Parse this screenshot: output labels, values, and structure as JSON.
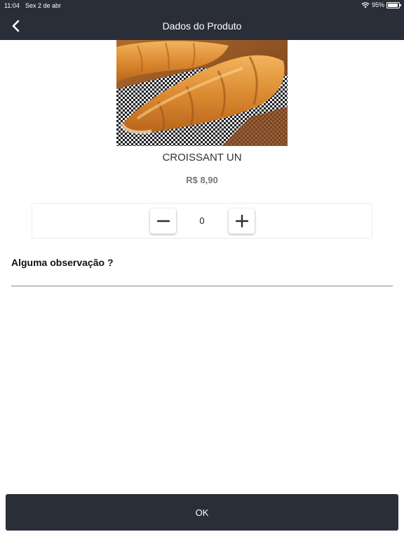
{
  "status_bar": {
    "time": "11:04",
    "date": "Sex 2 de abr",
    "battery": "95%",
    "battery_level": 0.95
  },
  "header": {
    "title": "Dados do Produto",
    "back_icon": "chevron-left-icon"
  },
  "product": {
    "name": "CROISSANT UN",
    "price": "R$ 8,90"
  },
  "quantity": {
    "value": "0",
    "minus_icon": "minus-icon",
    "plus_icon": "plus-icon"
  },
  "observation": {
    "label": "Alguma observação ?",
    "value": "",
    "placeholder": ""
  },
  "footer": {
    "ok_label": "OK"
  },
  "colors": {
    "header_bg": "#2a2e38",
    "button_bg": "#2a2e38",
    "price_text": "#777777"
  }
}
